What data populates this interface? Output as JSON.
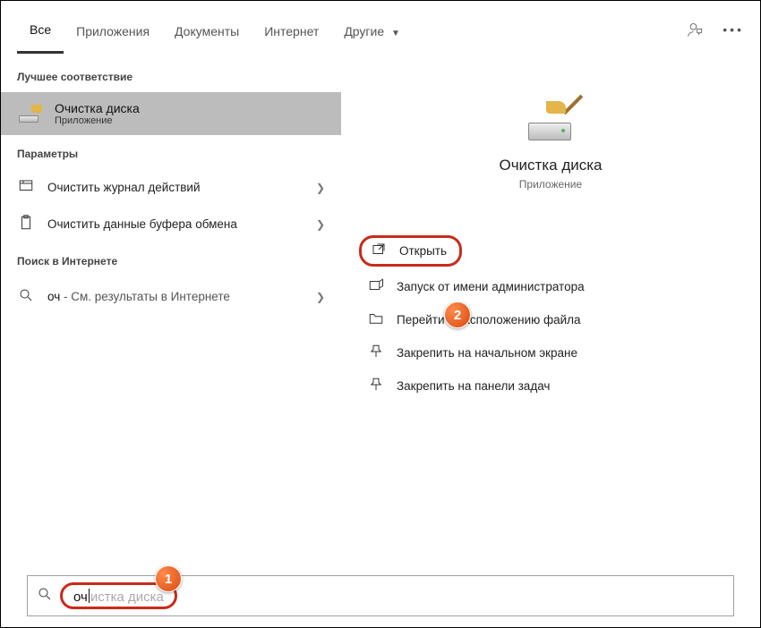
{
  "tabs": {
    "all": "Все",
    "apps": "Приложения",
    "docs": "Документы",
    "web": "Интернет",
    "other": "Другие"
  },
  "sections": {
    "best_match": "Лучшее соответствие",
    "settings": "Параметры",
    "web_search": "Поиск в Интернете"
  },
  "best_match": {
    "title": "Очистка диска",
    "subtitle": "Приложение"
  },
  "settings_items": [
    {
      "label": "Очистить журнал действий"
    },
    {
      "label": "Очистить данные буфера обмена"
    }
  ],
  "web_item": {
    "query": "оч",
    "suffix": " - См. результаты в Интернете"
  },
  "hero": {
    "title": "Очистка диска",
    "subtitle": "Приложение"
  },
  "actions": {
    "open": "Открыть",
    "run_admin": "Запуск от имени администратора",
    "open_location": "Перейти к расположению файла",
    "pin_start": "Закрепить на начальном экране",
    "pin_taskbar": "Закрепить на панели задач"
  },
  "search": {
    "typed": "оч",
    "ghost": "истка диска"
  },
  "badges": {
    "b1": "1",
    "b2": "2"
  }
}
